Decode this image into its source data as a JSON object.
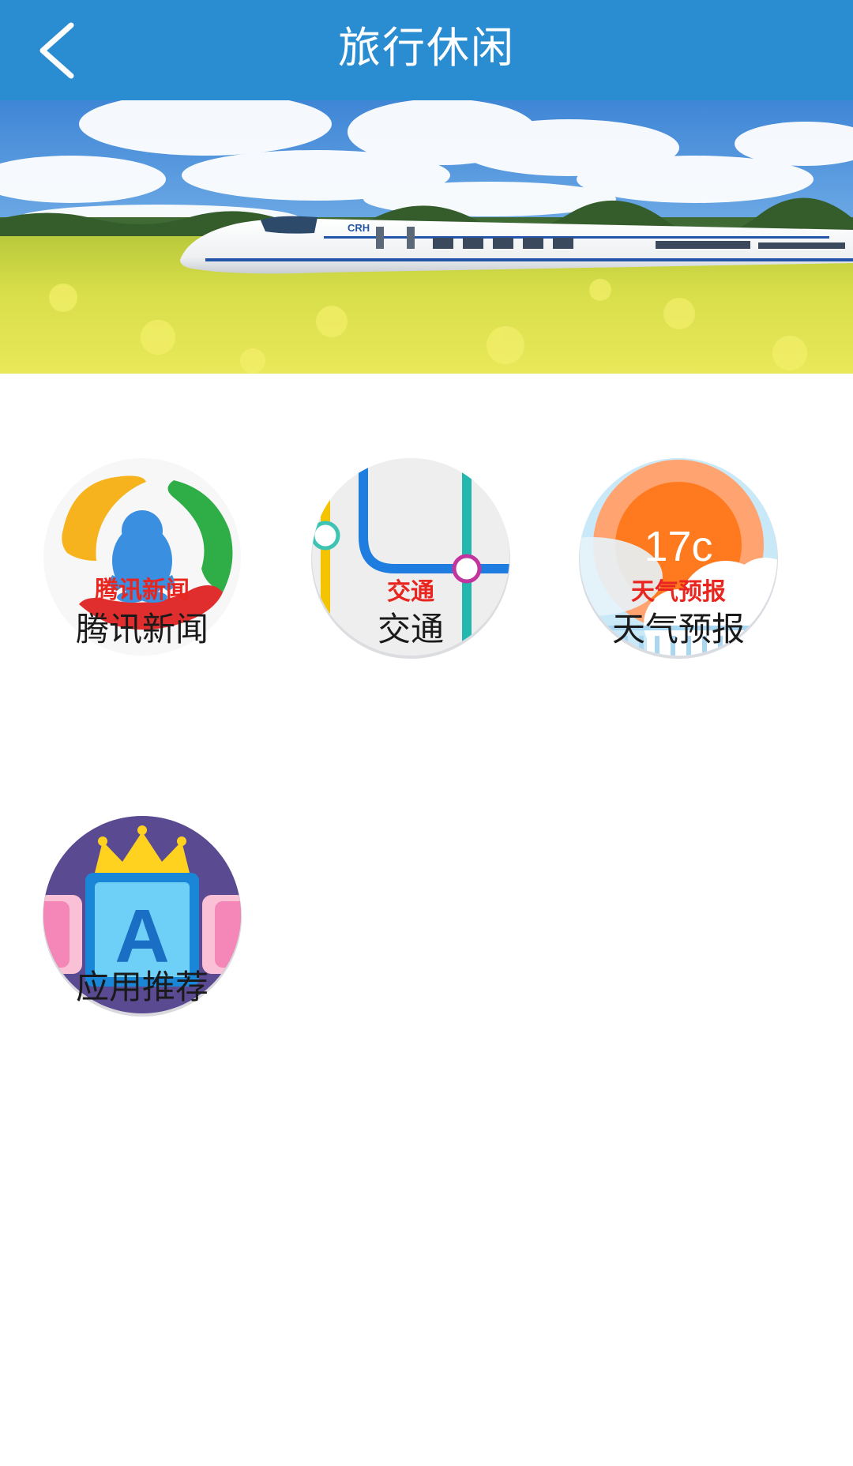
{
  "header": {
    "title": "旅行休闲",
    "back_icon": "chevron-left-icon",
    "background": "#2a8dd2"
  },
  "banner": {
    "image": "high-speed-train-in-rapeseed-field",
    "train_text": "CRH"
  },
  "apps": [
    {
      "badge": "腾讯新闻",
      "label": "腾讯新闻",
      "icon": "tencent-news-icon"
    },
    {
      "badge": "交通",
      "label": "交通",
      "icon": "transit-map-icon"
    },
    {
      "badge": "天气预报",
      "label": "天气预报",
      "icon": "weather-icon",
      "temperature": "17c"
    },
    {
      "badge": "",
      "label": "应用推荐",
      "icon": "app-recommend-icon",
      "letter": "A"
    }
  ],
  "colors": {
    "badge_text": "#e8261f",
    "label_text": "#1a1a1a"
  }
}
